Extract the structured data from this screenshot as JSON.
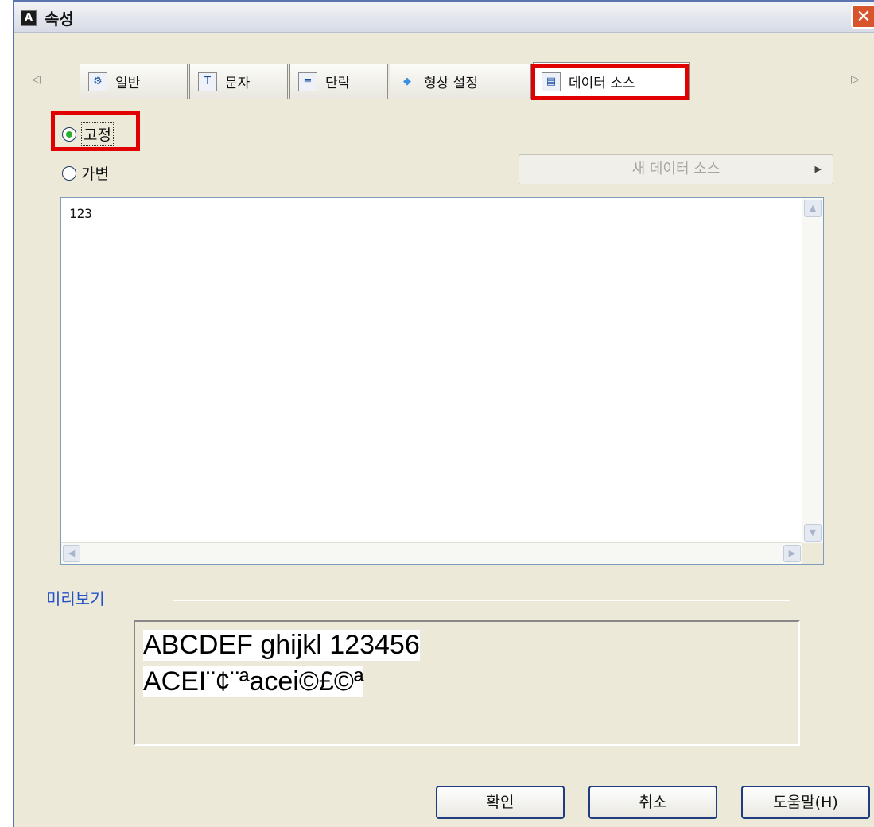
{
  "dialog": {
    "title": "속성",
    "title_icon": "A",
    "close_icon": "close-icon"
  },
  "tabs": [
    {
      "label": "일반",
      "icon": "gear-icon"
    },
    {
      "label": "문자",
      "icon": "text-icon"
    },
    {
      "label": "단락",
      "icon": "paragraph-icon"
    },
    {
      "label": "형상 설정",
      "icon": "shape-icon"
    },
    {
      "label": "데이터 소스",
      "icon": "database-icon",
      "active": true
    }
  ],
  "tab_nav": {
    "prev": "◁",
    "next": "▷"
  },
  "source_mode": {
    "fixed_label": "고정",
    "variable_label": "가변",
    "selected": "fixed"
  },
  "new_source_button": {
    "label": "새 데이터 소스",
    "arrow": "▶"
  },
  "editor": {
    "content": "123"
  },
  "preview": {
    "label": "미리보기",
    "line1": "ABCDEF ghijkl 123456",
    "line2": "ACEI¨¢¨ªacei©£©ª"
  },
  "buttons": {
    "ok": "확인",
    "cancel": "취소",
    "help": "도움말(H)"
  },
  "highlight_color": "#e00000"
}
